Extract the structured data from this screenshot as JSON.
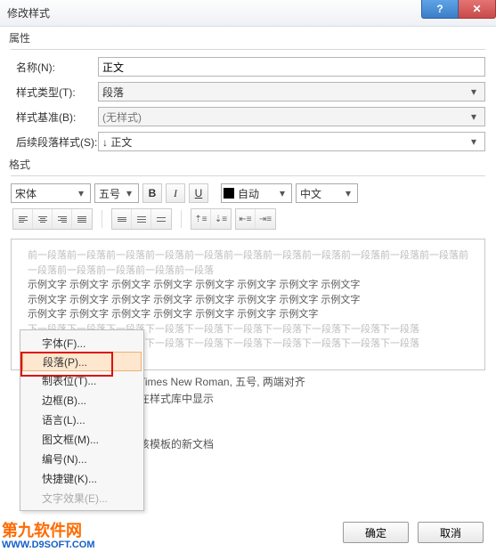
{
  "window": {
    "title": "修改样式"
  },
  "groups": {
    "properties": "属性",
    "format": "格式"
  },
  "labels": {
    "name": "名称(N):",
    "styleType": "样式类型(T):",
    "styleBase": "样式基准(B):",
    "nextStyle": "后续段落样式(S):"
  },
  "values": {
    "name": "正文",
    "styleType": "段落",
    "styleBase": "(无样式)",
    "nextStyle": "↓ 正文"
  },
  "format": {
    "fontName": "宋体",
    "fontSize": "五号",
    "bold": "B",
    "italic": "I",
    "underline": "U",
    "autoColor": "自动",
    "lang": "中文"
  },
  "preview": {
    "grayTop": "前一段落前一段落前一段落前一段落前一段落前一段落前一段落前一段落前一段落前一段落前一段落前一段落前一段落前一段落前一段落前一段落",
    "sample1": "示例文字 示例文字 示例文字 示例文字 示例文字 示例文字 示例文字 示例文字",
    "sample2": "示例文字 示例文字 示例文字 示例文字 示例文字 示例文字 示例文字 示例文字",
    "sample3": "示例文字 示例文字 示例文字 示例文字 示例文字 示例文字 示例文字",
    "grayBot1": "下一段落下一段落下一段落下一段落下一段落下一段落下一段落下一段落下一段落下一段落",
    "grayBot2": "下一段落下一段落下一段落下一段落下一段落下一段落下一段落下一段落下一段落下一段落"
  },
  "desc": {
    "line1": "Times New Roman, 五号, 两端对齐",
    "line2": "在样式库中显示",
    "line3": "该模板的新文档"
  },
  "buttons": {
    "ok": "确定",
    "cancel": "取消"
  },
  "menu": {
    "font": "字体(F)...",
    "paragraph": "段落(P)...",
    "tabs": "制表位(T)...",
    "border": "边框(B)...",
    "language": "语言(L)...",
    "frame": "图文框(M)...",
    "numbering": "编号(N)...",
    "shortcut": "快捷键(K)...",
    "textEffects": "文字效果(E)..."
  },
  "watermark": {
    "brand": "第九软件网",
    "url": "WWW.D9SOFT.COM"
  }
}
